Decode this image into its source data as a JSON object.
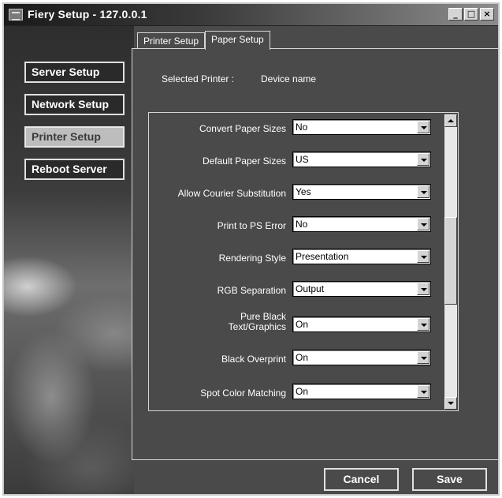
{
  "window": {
    "title": "Fiery Setup - 127.0.0.1",
    "controls": [
      "_",
      "□",
      "×"
    ]
  },
  "sidebar": {
    "items": [
      {
        "label": "Server Setup",
        "active": false
      },
      {
        "label": "Network Setup",
        "active": false
      },
      {
        "label": "Printer Setup",
        "active": true
      },
      {
        "label": "Reboot Server",
        "active": false
      }
    ]
  },
  "tabs": [
    {
      "label": "Printer Setup",
      "active": false
    },
    {
      "label": "Paper Setup",
      "active": true
    }
  ],
  "selected_printer": {
    "label": "Selected Printer :",
    "value": "Device name"
  },
  "settings": [
    {
      "label": "Convert Paper Sizes",
      "value": "No"
    },
    {
      "label": "Default Paper Sizes",
      "value": "US"
    },
    {
      "label": "Allow Courier Substitution",
      "value": "Yes"
    },
    {
      "label": "Print to PS Error",
      "value": "No"
    },
    {
      "label": "Rendering Style",
      "value": "Presentation"
    },
    {
      "label": "RGB Separation",
      "value": "Output"
    },
    {
      "label": "Pure Black Text/Graphics",
      "value": "On"
    },
    {
      "label": "Black Overprint",
      "value": "On"
    },
    {
      "label": "Spot Color Matching",
      "value": "On"
    }
  ],
  "buttons": {
    "cancel": "Cancel",
    "save": "Save"
  },
  "colors": {
    "panel_bg": "#4a4a4a",
    "active_nav_bg": "#bdbdbd",
    "text": "#ffffff"
  }
}
